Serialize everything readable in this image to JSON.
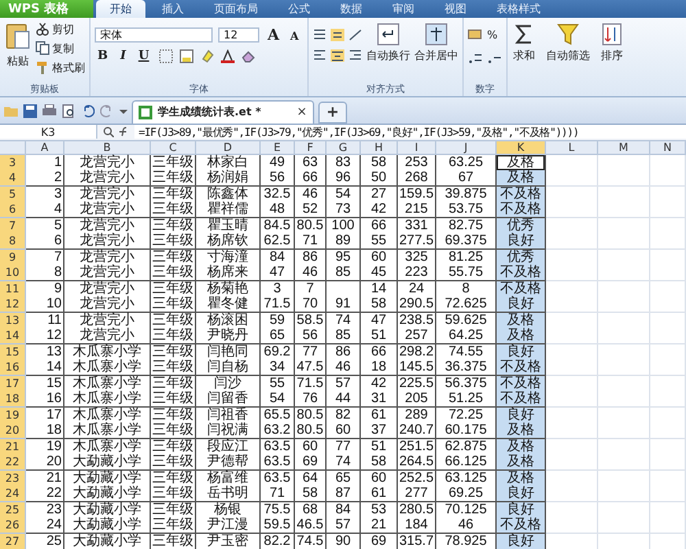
{
  "app_button": {
    "label": "WPS 表格"
  },
  "tabs": [
    {
      "label": "开始",
      "selected": true
    },
    {
      "label": "插入",
      "selected": false
    },
    {
      "label": "页面布局",
      "selected": false
    },
    {
      "label": "公式",
      "selected": false
    },
    {
      "label": "数据",
      "selected": false
    },
    {
      "label": "审阅",
      "selected": false
    },
    {
      "label": "视图",
      "selected": false
    },
    {
      "label": "表格样式",
      "selected": false
    }
  ],
  "ribbon": {
    "clipboard": {
      "paste": "粘贴",
      "cut": "剪切",
      "copy": "复制",
      "painter": "格式刷",
      "label": "剪贴板"
    },
    "font": {
      "name": "宋体",
      "size": "12",
      "grow": "A",
      "shrink": "A",
      "bold": "B",
      "italic": "I",
      "underline": "U",
      "label": "字体"
    },
    "alignment": {
      "wrap": "自动换行",
      "merge": "合并居中",
      "label": "对齐方式"
    },
    "number": {
      "percent": "%",
      "label": "数字"
    },
    "sum": "求和",
    "filter": "自动筛选",
    "sort": "排序"
  },
  "document_tab": {
    "title": "学生成绩统计表.et *",
    "close": "×",
    "new": "+"
  },
  "formula_bar": {
    "name_box": "K3",
    "formula": "=IF(J3>89,\"最优秀\",IF(J3>79,\"优秀\",IF(J3>69,\"良好\",IF(J3>59,\"及格\",\"不及格\"))))"
  },
  "columns": [
    {
      "label": "A",
      "selected": false
    },
    {
      "label": "B",
      "selected": false
    },
    {
      "label": "C",
      "selected": false
    },
    {
      "label": "D",
      "selected": false
    },
    {
      "label": "E",
      "selected": false
    },
    {
      "label": "F",
      "selected": false
    },
    {
      "label": "G",
      "selected": false
    },
    {
      "label": "H",
      "selected": false
    },
    {
      "label": "I",
      "selected": false
    },
    {
      "label": "J",
      "selected": false
    },
    {
      "label": "K",
      "selected": true
    },
    {
      "label": "L",
      "selected": false
    },
    {
      "label": "M",
      "selected": false
    },
    {
      "label": "N",
      "selected": false
    }
  ],
  "rows": [
    {
      "number": "3",
      "selected": true,
      "active": true,
      "cells": [
        "1",
        "龙营完小",
        "三年级",
        "林家白",
        "49",
        "63",
        "83",
        "58",
        "253",
        "63.25",
        "及格"
      ]
    },
    {
      "number": "4",
      "selected": true,
      "active": false,
      "cells": [
        "2",
        "龙营完小",
        "三年级",
        "杨润娟",
        "56",
        "66",
        "96",
        "50",
        "268",
        "67",
        "及格"
      ]
    },
    {
      "number": "5",
      "selected": true,
      "active": false,
      "cells": [
        "3",
        "龙营完小",
        "三年级",
        "陈鑫体",
        "32.5",
        "46",
        "54",
        "27",
        "159.5",
        "39.875",
        "不及格"
      ]
    },
    {
      "number": "6",
      "selected": true,
      "active": false,
      "cells": [
        "4",
        "龙营完小",
        "三年级",
        "瞿祥儒",
        "48",
        "52",
        "73",
        "42",
        "215",
        "53.75",
        "不及格"
      ]
    },
    {
      "number": "7",
      "selected": true,
      "active": false,
      "cells": [
        "5",
        "龙营完小",
        "三年级",
        "瞿玉晴",
        "84.5",
        "80.5",
        "100",
        "66",
        "331",
        "82.75",
        "优秀"
      ]
    },
    {
      "number": "8",
      "selected": true,
      "active": false,
      "cells": [
        "6",
        "龙营完小",
        "三年级",
        "杨席钦",
        "62.5",
        "71",
        "89",
        "55",
        "277.5",
        "69.375",
        "良好"
      ]
    },
    {
      "number": "9",
      "selected": true,
      "active": false,
      "cells": [
        "7",
        "龙营完小",
        "三年级",
        "寸海潼",
        "84",
        "86",
        "95",
        "60",
        "325",
        "81.25",
        "优秀"
      ]
    },
    {
      "number": "10",
      "selected": true,
      "active": false,
      "cells": [
        "8",
        "龙营完小",
        "三年级",
        "杨席来",
        "47",
        "46",
        "85",
        "45",
        "223",
        "55.75",
        "不及格"
      ]
    },
    {
      "number": "11",
      "selected": true,
      "active": false,
      "cells": [
        "9",
        "龙营完小",
        "三年级",
        "杨菊艳",
        "3",
        "7",
        "",
        "14",
        "24",
        "8",
        "不及格"
      ]
    },
    {
      "number": "12",
      "selected": true,
      "active": false,
      "cells": [
        "10",
        "龙营完小",
        "三年级",
        "瞿冬健",
        "71.5",
        "70",
        "91",
        "58",
        "290.5",
        "72.625",
        "良好"
      ]
    },
    {
      "number": "13",
      "selected": true,
      "active": false,
      "cells": [
        "11",
        "龙营完小",
        "三年级",
        "杨滚困",
        "59",
        "58.5",
        "74",
        "47",
        "238.5",
        "59.625",
        "及格"
      ]
    },
    {
      "number": "14",
      "selected": true,
      "active": false,
      "cells": [
        "12",
        "龙营完小",
        "三年级",
        "尹晓丹",
        "65",
        "56",
        "85",
        "51",
        "257",
        "64.25",
        "及格"
      ]
    },
    {
      "number": "15",
      "selected": true,
      "active": false,
      "cells": [
        "13",
        "木瓜寨小学",
        "三年级",
        "闫艳同",
        "69.2",
        "77",
        "86",
        "66",
        "298.2",
        "74.55",
        "良好"
      ]
    },
    {
      "number": "16",
      "selected": true,
      "active": false,
      "cells": [
        "14",
        "木瓜寨小学",
        "三年级",
        "闫自杨",
        "34",
        "47.5",
        "46",
        "18",
        "145.5",
        "36.375",
        "不及格"
      ]
    },
    {
      "number": "17",
      "selected": true,
      "active": false,
      "cells": [
        "15",
        "木瓜寨小学",
        "三年级",
        "闫沙",
        "55",
        "71.5",
        "57",
        "42",
        "225.5",
        "56.375",
        "不及格"
      ]
    },
    {
      "number": "18",
      "selected": true,
      "active": false,
      "cells": [
        "16",
        "木瓜寨小学",
        "三年级",
        "闫留香",
        "54",
        "76",
        "44",
        "31",
        "205",
        "51.25",
        "不及格"
      ]
    },
    {
      "number": "19",
      "selected": true,
      "active": false,
      "cells": [
        "17",
        "木瓜寨小学",
        "三年级",
        "闫祖香",
        "65.5",
        "80.5",
        "82",
        "61",
        "289",
        "72.25",
        "良好"
      ]
    },
    {
      "number": "20",
      "selected": true,
      "active": false,
      "cells": [
        "18",
        "木瓜寨小学",
        "三年级",
        "闫祝满",
        "63.2",
        "80.5",
        "60",
        "37",
        "240.7",
        "60.175",
        "及格"
      ]
    },
    {
      "number": "21",
      "selected": true,
      "active": false,
      "cells": [
        "19",
        "木瓜寨小学",
        "三年级",
        "段应江",
        "63.5",
        "60",
        "77",
        "51",
        "251.5",
        "62.875",
        "及格"
      ]
    },
    {
      "number": "22",
      "selected": true,
      "active": false,
      "cells": [
        "20",
        "大勐藏小学",
        "三年级",
        "尹德帮",
        "63.5",
        "69",
        "74",
        "58",
        "264.5",
        "66.125",
        "及格"
      ]
    },
    {
      "number": "23",
      "selected": true,
      "active": false,
      "cells": [
        "21",
        "大勐藏小学",
        "三年级",
        "杨富维",
        "63.5",
        "64",
        "65",
        "60",
        "252.5",
        "63.125",
        "及格"
      ]
    },
    {
      "number": "24",
      "selected": true,
      "active": false,
      "cells": [
        "22",
        "大勐藏小学",
        "三年级",
        "岳书明",
        "71",
        "58",
        "87",
        "61",
        "277",
        "69.25",
        "良好"
      ]
    },
    {
      "number": "25",
      "selected": true,
      "active": false,
      "cells": [
        "23",
        "大勐藏小学",
        "三年级",
        "杨银",
        "75.5",
        "68",
        "84",
        "53",
        "280.5",
        "70.125",
        "良好"
      ]
    },
    {
      "number": "26",
      "selected": true,
      "active": false,
      "cells": [
        "24",
        "大勐藏小学",
        "三年级",
        "尹江漫",
        "59.5",
        "46.5",
        "57",
        "21",
        "184",
        "46",
        "不及格"
      ]
    },
    {
      "number": "27",
      "selected": true,
      "active": false,
      "cells": [
        "25",
        "大勐藏小学",
        "三年级",
        "尹玉密",
        "82.2",
        "74.5",
        "90",
        "69",
        "315.7",
        "78.925",
        "良好"
      ]
    }
  ]
}
